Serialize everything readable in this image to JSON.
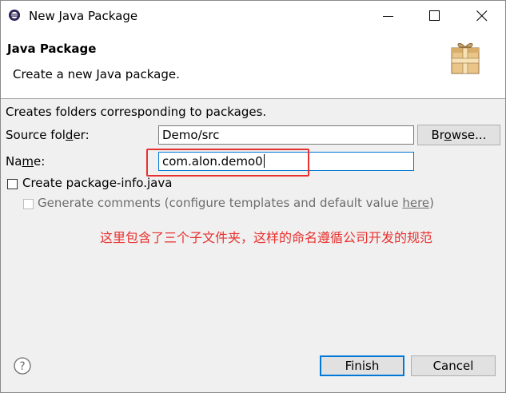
{
  "window": {
    "title": "New Java Package",
    "app_icon": "eclipse-icon",
    "controls": [
      "minimize-icon",
      "maximize-icon",
      "close-icon"
    ]
  },
  "header": {
    "title": "Java Package",
    "description": "Create a new Java package.",
    "icon": "package-icon"
  },
  "form": {
    "intro": "Creates folders corresponding to packages.",
    "source_folder": {
      "label_pre": "Source fol",
      "label_mnemonic": "d",
      "label_post": "er:",
      "value": "Demo/src",
      "browse_pre": "Br",
      "browse_mnemonic": "o",
      "browse_post": "wse..."
    },
    "name": {
      "label_pre": "Na",
      "label_mnemonic": "m",
      "label_post": "e:",
      "value": "com.alon.demo0"
    },
    "create_package_info": {
      "label": "Create package-info.java",
      "checked": false
    },
    "generate_comments": {
      "label_pre": "Generate comments (configure templates and default value ",
      "link": "here",
      "label_post": ")",
      "checked": false,
      "enabled": false
    }
  },
  "annotation": {
    "text": "这里包含了三个子文件夹，这样的命名遵循公司开发的规范",
    "color": "#e8312f"
  },
  "footer": {
    "help_icon": "help-icon",
    "finish_label": "Finish",
    "cancel_label": "Cancel"
  },
  "colors": {
    "accent": "#0078d7",
    "annotation": "#e8312f"
  }
}
